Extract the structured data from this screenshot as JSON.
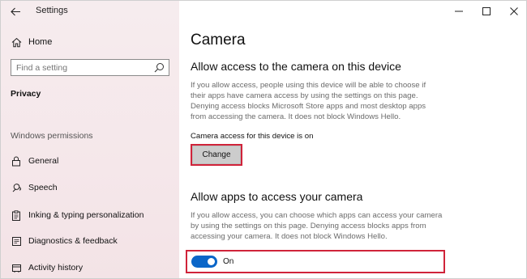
{
  "window": {
    "app_title": "Settings",
    "controls": [
      "minimize",
      "maximize",
      "close"
    ]
  },
  "sidebar": {
    "home_label": "Home",
    "search": {
      "placeholder": "Find a setting",
      "value": ""
    },
    "category_label": "Privacy",
    "section_heading": "Windows permissions",
    "items": [
      {
        "label": "General",
        "icon": "lock-icon"
      },
      {
        "label": "Speech",
        "icon": "speech-icon"
      },
      {
        "label": "Inking & typing personalization",
        "icon": "clipboard-icon"
      },
      {
        "label": "Diagnostics & feedback",
        "icon": "diagnostics-icon"
      },
      {
        "label": "Activity history",
        "icon": "history-icon"
      }
    ]
  },
  "main": {
    "title": "Camera",
    "device_section": {
      "heading": "Allow access to the camera on this device",
      "description_lines": [
        "If you allow access, people using this device will be able to choose if",
        "their apps have camera access by using the settings on this page.",
        "Denying access blocks Microsoft Store apps and most desktop apps",
        "from accessing the camera. It does not block Windows Hello."
      ],
      "status": "Camera access for this device is on",
      "change_button": "Change"
    },
    "apps_section": {
      "heading": "Allow apps to access your camera",
      "description_lines": [
        "If you allow access, you can choose which apps can access your camera",
        "by using the settings on this page. Denying access blocks apps from",
        "accessing your camera. It does not block Windows Hello."
      ],
      "toggle_state": "On",
      "toggle_on": true
    }
  },
  "colors": {
    "accent": "#0a66c8",
    "highlight": "#d0233a",
    "sidebar_bg": "#f5e7ea"
  }
}
